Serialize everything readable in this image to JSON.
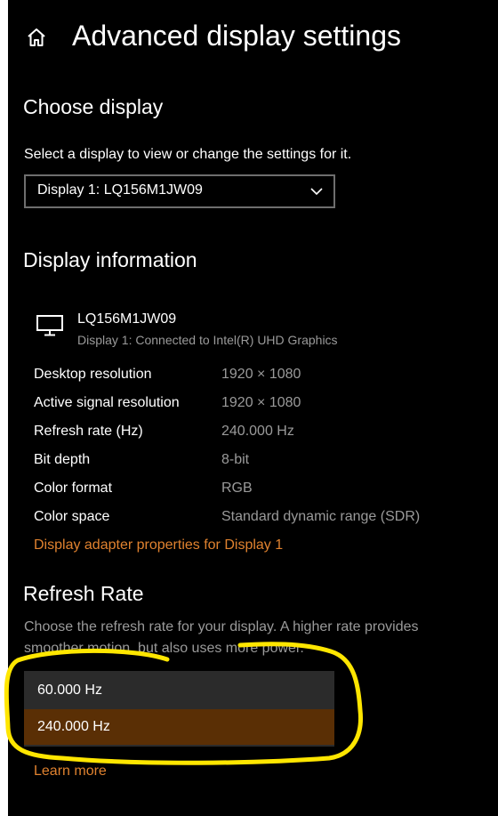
{
  "header": {
    "title": "Advanced display settings",
    "home_icon": "home-icon"
  },
  "choose_display": {
    "heading": "Choose display",
    "description": "Select a display to view or change the settings for it.",
    "selected": "Display 1: LQ156M1JW09"
  },
  "display_info": {
    "heading": "Display information",
    "monitor_icon": "monitor-icon",
    "name": "LQ156M1JW09",
    "subtitle": "Display 1: Connected to Intel(R) UHD Graphics",
    "rows": [
      {
        "label": "Desktop resolution",
        "value": "1920 × 1080"
      },
      {
        "label": "Active signal resolution",
        "value": "1920 × 1080"
      },
      {
        "label": "Refresh rate (Hz)",
        "value": "240.000 Hz"
      },
      {
        "label": "Bit depth",
        "value": "8-bit"
      },
      {
        "label": "Color format",
        "value": "RGB"
      },
      {
        "label": "Color space",
        "value": "Standard dynamic range (SDR)"
      }
    ],
    "adapter_link": "Display adapter properties for Display 1"
  },
  "refresh_rate": {
    "heading": "Refresh Rate",
    "description_line1": "Choose the refresh rate for your display. A higher rate provides",
    "description_line2": "smoother motion, but also uses more power.",
    "options": [
      "60.000 Hz",
      "240.000 Hz"
    ],
    "selected": "240.000 Hz",
    "learn_more": "Learn more"
  },
  "colors": {
    "background": "#000000",
    "link": "#e0822f",
    "selected_option": "#5a2f05",
    "annotation": "#ffe600"
  }
}
